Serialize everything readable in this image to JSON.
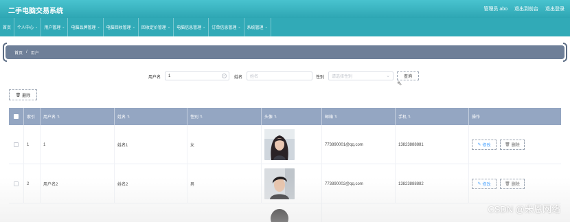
{
  "header": {
    "title": "二手电脑交易系统",
    "user_label": "管理员 abo",
    "exit_to_front": "退出到前台",
    "logout": "退出登录"
  },
  "nav": {
    "items": [
      {
        "label": "首页",
        "has_caret": false
      },
      {
        "label": "个人中心",
        "has_caret": true
      },
      {
        "label": "用户管理",
        "has_caret": true
      },
      {
        "label": "电脑品牌管理",
        "has_caret": true
      },
      {
        "label": "电脑回收管理",
        "has_caret": true
      },
      {
        "label": "回收定价管理",
        "has_caret": true
      },
      {
        "label": "电脑信息管理",
        "has_caret": true
      },
      {
        "label": "订单信息管理",
        "has_caret": true
      },
      {
        "label": "系统管理",
        "has_caret": true
      }
    ]
  },
  "breadcrumb": {
    "home": "首页",
    "separator": "/",
    "current": "用户"
  },
  "search": {
    "username_label": "用户名",
    "username_value": "1",
    "name_label": "姓名",
    "name_placeholder": "姓名",
    "gender_label": "性别",
    "gender_placeholder": "请选择性别",
    "query_button": "查询"
  },
  "toolbar": {
    "batch_delete": "删除"
  },
  "table": {
    "columns": [
      "",
      "索引",
      "用户名",
      "姓名",
      "性别",
      "头像",
      "邮箱",
      "手机",
      "操作"
    ],
    "rows": [
      {
        "index": "1",
        "username": "1",
        "name": "姓名1",
        "gender": "女",
        "email": "773890001@qq.com",
        "phone": "13823888881",
        "edit": "修改",
        "delete": "删除"
      },
      {
        "index": "2",
        "username": "用户名2",
        "name": "姓名2",
        "gender": "男",
        "email": "773890002@qq.com",
        "phone": "13823888882",
        "edit": "修改",
        "delete": "删除"
      }
    ]
  },
  "watermark": "CSDN @米恩网络",
  "colors": {
    "header": "#2ea6b3",
    "nav": "#31aab7",
    "breadcrumb": "#6e7f98",
    "table_header": "#94a6c2",
    "link": "#409eff"
  },
  "icons": {
    "sort": "sort-icon",
    "delete": "trash-icon",
    "edit": "edit-icon",
    "clear": "clear-icon",
    "dropdown": "chevron-down-icon"
  }
}
